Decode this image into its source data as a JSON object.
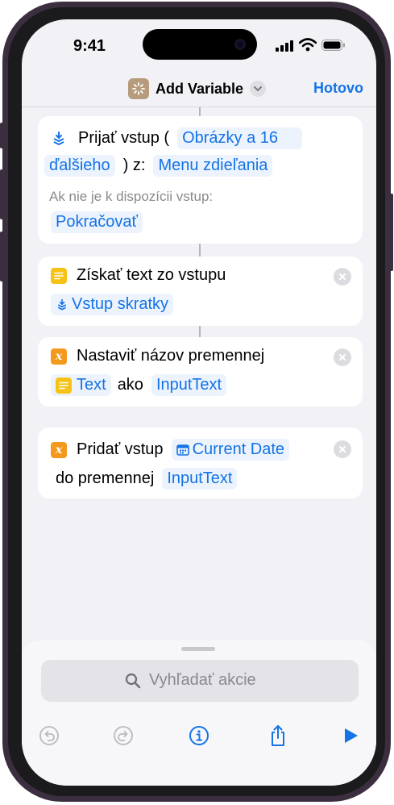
{
  "status_bar": {
    "time": "9:41"
  },
  "nav": {
    "title": "Add Variable",
    "done_label": "Hotovo"
  },
  "actions": [
    {
      "id": "receive-input",
      "verb": "Prijať vstup (",
      "types_token_part1": "Obrázky a 16",
      "types_token_part2": "ďalšieho",
      "from_label": ") z:",
      "source_token": "Menu zdieľania",
      "fallback_label": "Ak nie je k dispozícii vstup:",
      "fallback_token": "Pokračovať"
    },
    {
      "id": "get-text",
      "verb": "Získať text zo vstupu",
      "input_token": "Vstup skratky"
    },
    {
      "id": "set-variable",
      "verb": "Nastaviť názov premennej",
      "value_token": "Text",
      "as_label": "ako",
      "variable_token": "InputText"
    },
    {
      "id": "add-to-variable",
      "verb": "Pridať vstup",
      "value_token": "Current Date",
      "to_label": "do premennej",
      "variable_token": "InputText"
    }
  ],
  "search": {
    "placeholder": "Vyhľadať akcie"
  },
  "icons": {
    "shortcuts-input": "layers-icon",
    "text": "text-lines-icon",
    "variable": "x-variable-icon",
    "date": "calendar-icon"
  },
  "colors": {
    "accent": "#1473E6",
    "yellow": "#F5C215",
    "orange": "#F39A1E",
    "app_icon": "#B69C7C"
  }
}
